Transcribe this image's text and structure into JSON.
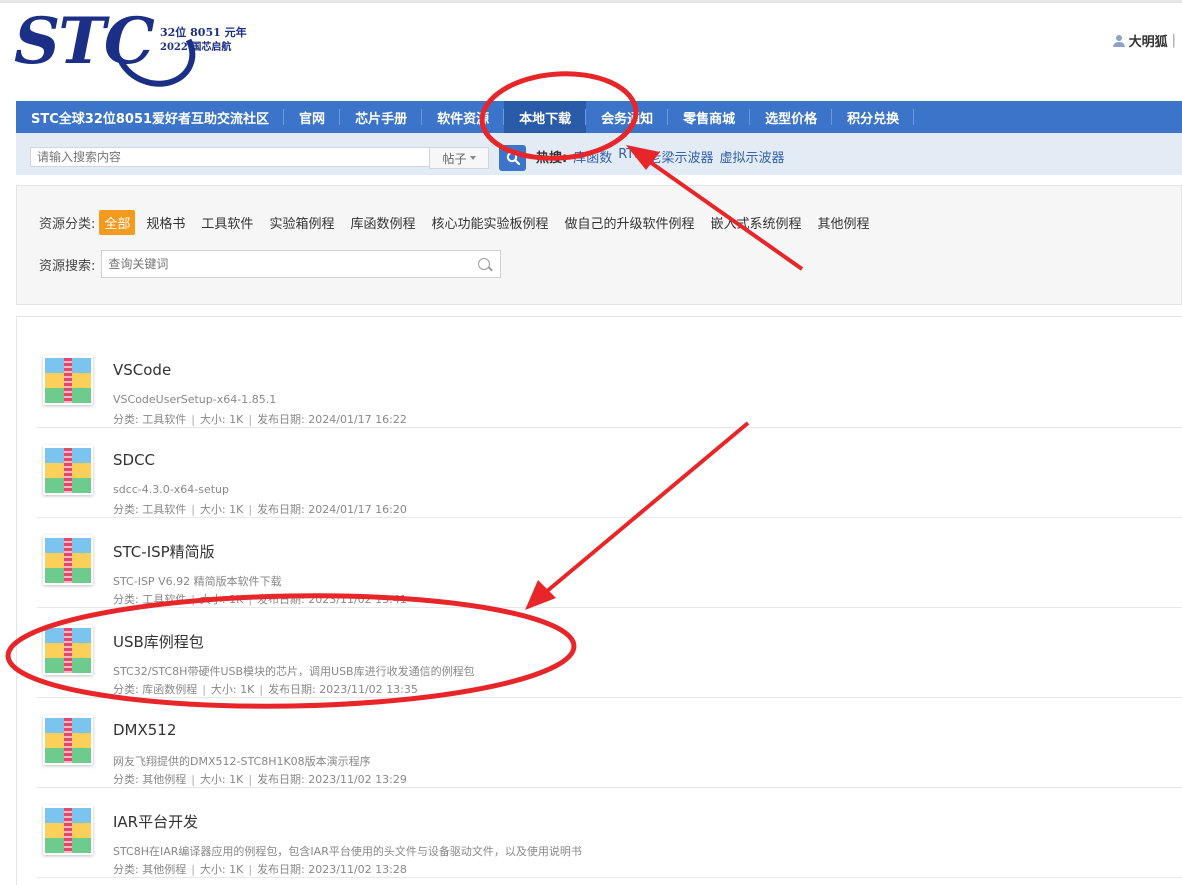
{
  "header": {
    "logo_text": "STC",
    "logo_tag_line1": "32位 8051 元年",
    "logo_tag_line2": "2022 国芯启航",
    "user_name": "大明狐",
    "user_sep": "|"
  },
  "nav": {
    "items": [
      {
        "label": "STC全球32位8051爱好者互助交流社区"
      },
      {
        "label": "官网"
      },
      {
        "label": "芯片手册"
      },
      {
        "label": "软件资源"
      },
      {
        "label": "本地下载",
        "active": true
      },
      {
        "label": "会务通知"
      },
      {
        "label": "零售商城"
      },
      {
        "label": "选型价格"
      },
      {
        "label": "积分兑换"
      }
    ]
  },
  "search": {
    "placeholder": "请输入搜索内容",
    "type_label": "帖子",
    "hot_label": "热搜:",
    "hot_links": [
      "库函数",
      "RTS",
      "老梁示波器",
      "虚拟示波器"
    ]
  },
  "filters": {
    "category_label": "资源分类:",
    "categories": [
      "全部",
      "规格书",
      "工具软件",
      "实验箱例程",
      "库函数例程",
      "核心功能实验板例程",
      "做自己的升级软件例程",
      "嵌入式系统例程",
      "其他例程"
    ],
    "active_category": "全部",
    "search_label": "资源搜索:",
    "search_placeholder": "查询关键词"
  },
  "list": {
    "meta_category_prefix": "分类: ",
    "meta_size_prefix": "大小: ",
    "meta_date_prefix": "发布日期: ",
    "items": [
      {
        "title": "VSCode",
        "desc": "VSCodeUserSetup-x64-1.85.1",
        "category": "工具软件",
        "size": "1K",
        "date": "2024/01/17 16:22"
      },
      {
        "title": "SDCC",
        "desc": "sdcc-4.3.0-x64-setup",
        "category": "工具软件",
        "size": "1K",
        "date": "2024/01/17 16:20"
      },
      {
        "title": "STC-ISP精简版",
        "desc": "STC-ISP V6.92 精简版本软件下载",
        "category": "工具软件",
        "size": "1K",
        "date": "2023/11/02 13:41"
      },
      {
        "title": "USB库例程包",
        "desc": "STC32/STC8H带硬件USB模块的芯片，调用USB库进行收发通信的例程包",
        "category": "库函数例程",
        "size": "1K",
        "date": "2023/11/02 13:35"
      },
      {
        "title": "DMX512",
        "desc": "网友飞翔提供的DMX512-STC8H1K08版本演示程序",
        "category": "其他例程",
        "size": "1K",
        "date": "2023/11/02 13:29"
      },
      {
        "title": "IAR平台开发",
        "desc": "STC8H在IAR编译器应用的例程包，包含IAR平台使用的头文件与设备驱动文件，以及使用说明书",
        "category": "其他例程",
        "size": "1K",
        "date": "2023/11/02 13:28"
      }
    ]
  },
  "colors": {
    "nav_bg": "#3b74c9",
    "active_category_bg": "#f39a1f",
    "annotation_red": "#e8262a"
  }
}
